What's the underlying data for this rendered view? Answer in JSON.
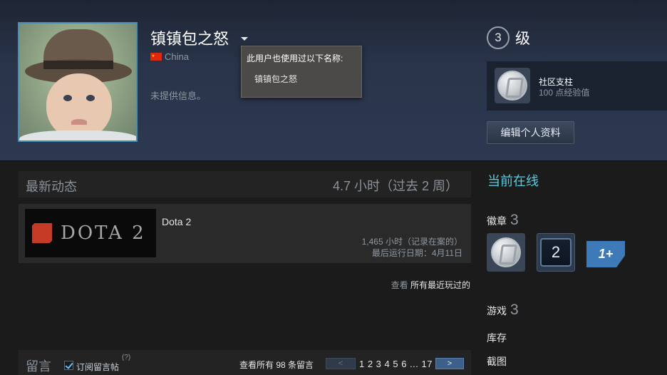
{
  "profile": {
    "persona_name": "镇镇包之怒",
    "country": "China",
    "summary": "未提供信息。",
    "alias_popup": {
      "title": "此用户也使用过以下名称:",
      "aliases": [
        "镇镇包之怒"
      ]
    },
    "level": {
      "value": "3",
      "label": "级"
    },
    "favorite_badge": {
      "title": "社区支柱",
      "xp": "100 点经验值"
    },
    "edit_button": "编辑个人资料"
  },
  "recent_activity": {
    "title": "最新动态",
    "hours": "4.7 小时（过去 2 周）",
    "game": {
      "name": "Dota 2",
      "capsule_text": "DOTA 2",
      "hours_on_record": "1,465 小时（记录在案的）",
      "last_played": "最后运行日期：4月11日"
    },
    "view_all_prefix": "查看",
    "view_all_link": "所有最近玩过的"
  },
  "comments": {
    "title": "留言",
    "subscribe_label": "订阅留言帖",
    "help": "(?)",
    "view_all": "查看所有 98 条留言",
    "prev": "<",
    "pages": "1 2 3 4 5 6 ... 17",
    "next": ">"
  },
  "sidebar": {
    "status": "当前在线",
    "badges_label": "徽章",
    "badges_count": "3",
    "years_badge": "2",
    "oneplus_badge": "1+",
    "games_label": "游戏",
    "games_count": "3",
    "inventory": "库存",
    "screenshots": "截图"
  },
  "colors": {
    "online": "#57cbde",
    "header_top": "#1e2533",
    "header_bottom": "#2c3950",
    "next_button": "#3e5f87"
  }
}
